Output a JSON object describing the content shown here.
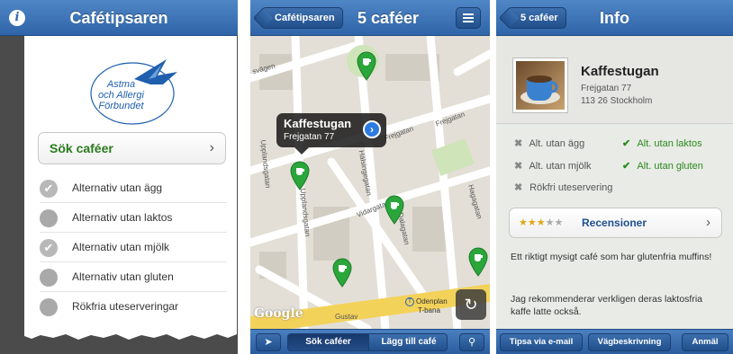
{
  "screen1": {
    "title": "Cafétipsaren",
    "info_icon": "i",
    "logo": {
      "line1": "Astma",
      "line2": "och Allergi",
      "line3": "Förbundet"
    },
    "search_label": "Sök caféer",
    "chevron": "›",
    "filters": [
      {
        "label": "Alternativ utan ägg",
        "checked": true
      },
      {
        "label": "Alternativ utan laktos",
        "checked": false
      },
      {
        "label": "Alternativ utan mjölk",
        "checked": true
      },
      {
        "label": "Alternativ utan gluten",
        "checked": false
      },
      {
        "label": "Rökfria uteserveringar",
        "checked": false
      }
    ]
  },
  "screen2": {
    "back_label": "Cafétipsaren",
    "title": "5 caféer",
    "callout": {
      "name": "Kaffestugan",
      "address": "Frejgatan 77"
    },
    "streets": [
      "Frejgatan",
      "Frejgatan",
      "Upplandsgatan",
      "Upplandsgatan",
      "Hälsingegatan",
      "Vidargatan",
      "Dalagatan",
      "Hagagatan",
      "Gustav",
      "Odenplan",
      "T-bana",
      "svägen"
    ],
    "map_logo": "Google",
    "toolbar": {
      "locate_icon": "➤",
      "tab_active": "Sök caféer",
      "tab_other": "Lägg till café",
      "search_icon": "⚲"
    }
  },
  "screen3": {
    "back_label": "5 caféer",
    "title": "Info",
    "cafe": {
      "name": "Kaffestugan",
      "street": "Frejgatan 77",
      "city": "113 26 Stockholm"
    },
    "features": [
      {
        "label": "Alt. utan ägg",
        "available": false,
        "mark": "✖"
      },
      {
        "label": "Alt. utan laktos",
        "available": true,
        "mark": "✔"
      },
      {
        "label": "Alt. utan mjölk",
        "available": false,
        "mark": "✖"
      },
      {
        "label": "Alt. utan gluten",
        "available": true,
        "mark": "✔"
      },
      {
        "label": "Rökfri uteservering",
        "available": false,
        "mark": "✖"
      }
    ],
    "rating": {
      "stars_filled": 3,
      "stars_total": 5
    },
    "reviews_label": "Recensioner",
    "chevron": "›",
    "description": [
      "Ett riktigt mysigt café som har glutenfria muffins!",
      "Jag rekommenderar verkligen deras laktosfria kaffe latte också."
    ],
    "buttons": {
      "email": "Tipsa via e-mail",
      "directions": "Vägbeskrivning",
      "report": "Anmäl"
    }
  },
  "colors": {
    "navbar": "#3a72b6",
    "green": "#2a8a1e",
    "pin": "#2aa63a",
    "star": "#e0a818"
  }
}
